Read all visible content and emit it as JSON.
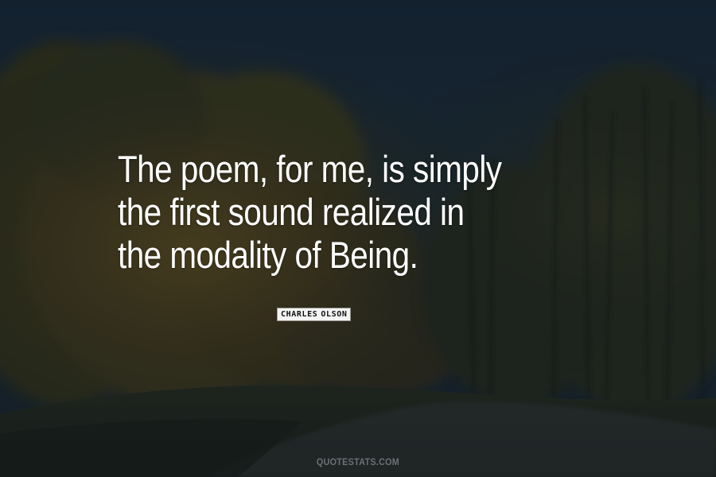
{
  "quote": {
    "lines": [
      "The poem, for me, is simply",
      "the first sound realized in",
      "the modality of Being."
    ]
  },
  "author": {
    "first": "CHARLES",
    "last": "OLSON"
  },
  "watermark": {
    "text": "QUOTESTATS.COM"
  },
  "colors": {
    "sky": "#1c3142",
    "foliage_warm": "#5a4a1c",
    "foliage_dark": "#27301e",
    "text": "#ffffff"
  }
}
